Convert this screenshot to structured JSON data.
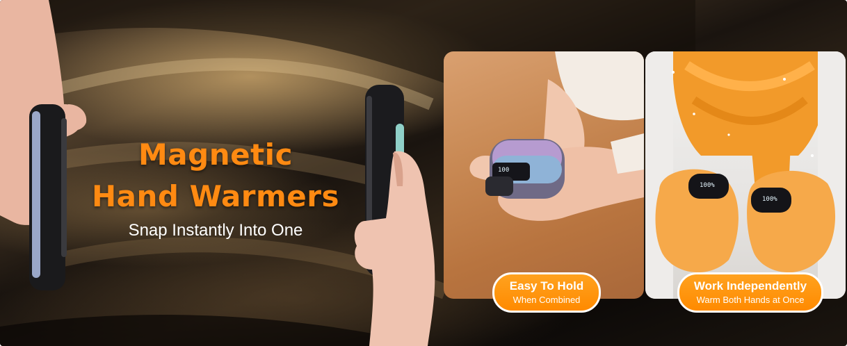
{
  "headline": {
    "line1": "Magnetic",
    "line2": "Hand Warmers",
    "subtitle": "Snap Instantly Into One"
  },
  "badges": {
    "hold": {
      "title": "Easy To Hold",
      "subtitle": "When Combined"
    },
    "warm": {
      "title": "Work Independently",
      "subtitle": "Warm Both Hands at Once"
    }
  },
  "displays": {
    "left_device": "100",
    "right_device_1": "100%",
    "right_device_2": "100%"
  },
  "colors": {
    "accent_orange": "#ff8a12",
    "badge_orange": "#ff9a10",
    "background_dark": "#1a140f",
    "subtitle_white": "#ffffff"
  },
  "icons": [
    "left-hand-with-device",
    "right-hand-with-device",
    "hand-warmer-device",
    "orange-scarf",
    "knit-mittens"
  ]
}
